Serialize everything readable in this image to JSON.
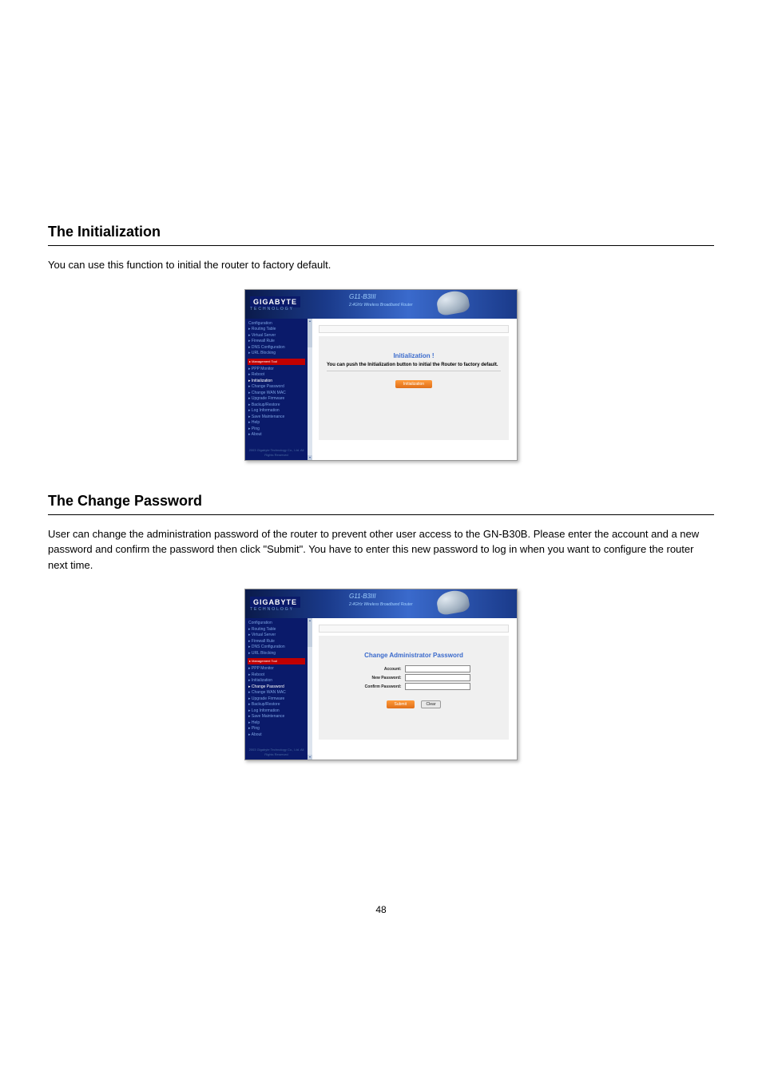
{
  "page_number": "48",
  "section1": {
    "title": "The Initialization",
    "body": "You can use this function to initial the router to factory default.",
    "screenshot": {
      "logo": "GIGABYTE",
      "logo_sub": "TECHNOLOGY",
      "product": "G11-B3III",
      "product_sub": "2.4GHz Wireless Broadband Router",
      "sidebar_pre": [
        "Configuration",
        "Routing Table",
        "Virtual Server",
        "Firewall Rule",
        "DNS Configuration",
        "URL Blocking"
      ],
      "sidebar_redbar": "Management Tool",
      "sidebar_items": [
        "PPP Monitor",
        "Reboot",
        "Initialization",
        "Change Password",
        "Change WAN MAC",
        "Upgrade Firmware",
        "Backup/Restore",
        "Log Information",
        "Save Maintenance",
        "Help",
        "Ping",
        "About"
      ],
      "sidebar_highlight": "Initialization",
      "sidebar_foot": "2003 Gigabyte Technology Co., Ltd. All Rights Reserved",
      "main_title": "Initialization !",
      "main_text": "You can push the Initialization button to initial the Router to factory default.",
      "button": "Initialization"
    }
  },
  "section2": {
    "title": "The Change Password",
    "body": "User can change the administration password of the router to prevent other user access to the GN-B30B. Please enter the account and a new password and confirm the password then click \"Submit\". You have to enter this new password to log in when you want to configure the router next time.",
    "screenshot": {
      "logo": "GIGABYTE",
      "logo_sub": "TECHNOLOGY",
      "product": "G11-B3III",
      "product_sub": "2.4GHz Wireless Broadband Router",
      "sidebar_pre": [
        "Configuration",
        "Routing Table",
        "Virtual Server",
        "Firewall Rule",
        "DNS Configuration",
        "URL Blocking"
      ],
      "sidebar_redbar": "Management Tool",
      "sidebar_items": [
        "PPP Monitor",
        "Reboot",
        "Initialization",
        "Change Password",
        "Change WAN MAC",
        "Upgrade Firmware",
        "Backup/Restore",
        "Log Information",
        "Save Maintenance",
        "Help",
        "Ping",
        "About"
      ],
      "sidebar_highlight": "Change Password",
      "sidebar_foot": "2003 Gigabyte Technology Co., Ltd. All Rights Reserved",
      "main_title": "Change Administrator Password",
      "form": {
        "account_label": "Account:",
        "newpw_label": "New Password:",
        "confirm_label": "Confirm Password:"
      },
      "button_submit": "Submit",
      "button_clear": "Clear"
    }
  }
}
